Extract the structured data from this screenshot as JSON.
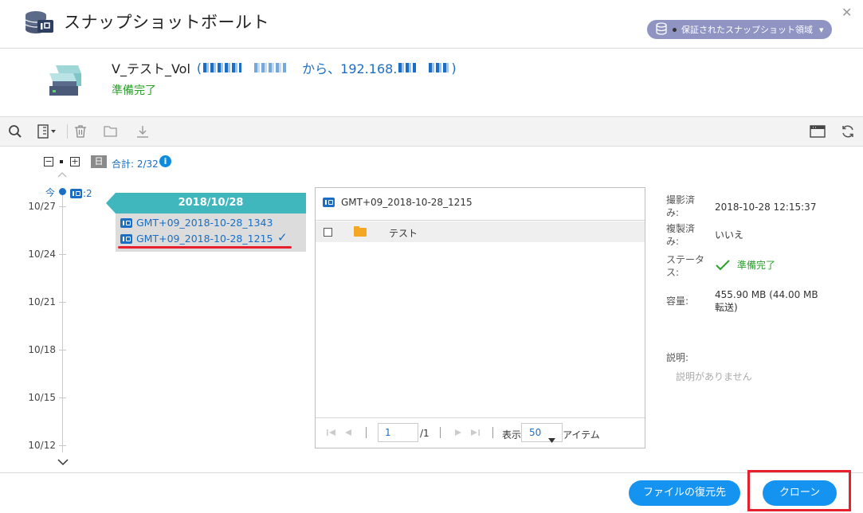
{
  "window": {
    "title": "スナップショットボールト",
    "close_glyph": "✕",
    "badge_label": "保証されたスナップショット領域",
    "badge_caret": "▾"
  },
  "volume": {
    "name": "V_テスト_Vol",
    "open_paren": "(",
    "from_text": "から、192.168.",
    "close_paren": ")",
    "status": "準備完了"
  },
  "zoom": {
    "minus": "−",
    "plus": "+",
    "day_chip": "日",
    "total": "合計: 2/32",
    "info": "i"
  },
  "timeline": {
    "now_label": "今",
    "count": ":2",
    "dates": [
      "10/27",
      "10/24",
      "10/21",
      "10/18",
      "10/15",
      "10/12"
    ]
  },
  "group": {
    "date": "2018/10/28",
    "snapshots": [
      "GMT+09_2018-10-28_1343",
      "GMT+09_2018-10-28_1215"
    ],
    "selected_check": "✓"
  },
  "file_panel": {
    "title": "GMT+09_2018-10-28_1215",
    "items": [
      {
        "name": "テスト"
      }
    ],
    "pager": {
      "page": "1",
      "of_pages": "/1",
      "show_label": "表示",
      "per_page": "50",
      "items_label": "アイテム"
    }
  },
  "details": {
    "taken_label": "撮影済み:",
    "taken_value": "2018-10-28 12:15:37",
    "replicated_label": "複製済み:",
    "replicated_value": "いいえ",
    "status_label": "ステータス:",
    "status_value": "準備完了",
    "size_label": "容量:",
    "size_value": "455.90 MB (44.00 MB 転送)",
    "desc_label": "説明:",
    "desc_value": "説明がありません"
  },
  "footer": {
    "restore_button": "ファイルの復元先",
    "clone_button": "クローン"
  },
  "colors": {
    "accent_blue": "#1a6ec4",
    "teal": "#3fb7bd",
    "ready_green": "#2aa02a",
    "highlight_red": "#e8202e",
    "button_blue": "#1593f1"
  }
}
